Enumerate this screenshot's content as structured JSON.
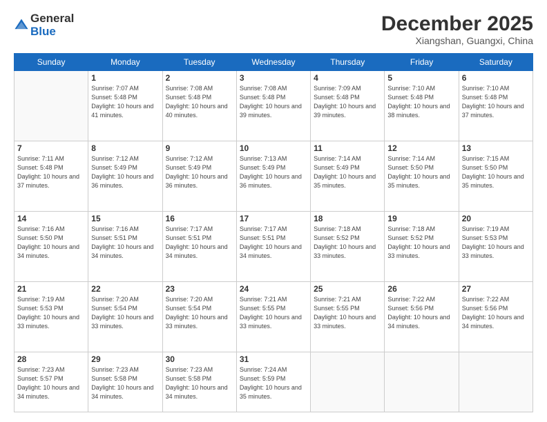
{
  "header": {
    "logo_line1": "General",
    "logo_line2": "Blue",
    "month": "December 2025",
    "location": "Xiangshan, Guangxi, China"
  },
  "weekdays": [
    "Sunday",
    "Monday",
    "Tuesday",
    "Wednesday",
    "Thursday",
    "Friday",
    "Saturday"
  ],
  "weeks": [
    [
      {
        "day": "",
        "info": ""
      },
      {
        "day": "1",
        "info": "Sunrise: 7:07 AM\nSunset: 5:48 PM\nDaylight: 10 hours\nand 41 minutes."
      },
      {
        "day": "2",
        "info": "Sunrise: 7:08 AM\nSunset: 5:48 PM\nDaylight: 10 hours\nand 40 minutes."
      },
      {
        "day": "3",
        "info": "Sunrise: 7:08 AM\nSunset: 5:48 PM\nDaylight: 10 hours\nand 39 minutes."
      },
      {
        "day": "4",
        "info": "Sunrise: 7:09 AM\nSunset: 5:48 PM\nDaylight: 10 hours\nand 39 minutes."
      },
      {
        "day": "5",
        "info": "Sunrise: 7:10 AM\nSunset: 5:48 PM\nDaylight: 10 hours\nand 38 minutes."
      },
      {
        "day": "6",
        "info": "Sunrise: 7:10 AM\nSunset: 5:48 PM\nDaylight: 10 hours\nand 37 minutes."
      }
    ],
    [
      {
        "day": "7",
        "info": "Sunrise: 7:11 AM\nSunset: 5:48 PM\nDaylight: 10 hours\nand 37 minutes."
      },
      {
        "day": "8",
        "info": "Sunrise: 7:12 AM\nSunset: 5:49 PM\nDaylight: 10 hours\nand 36 minutes."
      },
      {
        "day": "9",
        "info": "Sunrise: 7:12 AM\nSunset: 5:49 PM\nDaylight: 10 hours\nand 36 minutes."
      },
      {
        "day": "10",
        "info": "Sunrise: 7:13 AM\nSunset: 5:49 PM\nDaylight: 10 hours\nand 36 minutes."
      },
      {
        "day": "11",
        "info": "Sunrise: 7:14 AM\nSunset: 5:49 PM\nDaylight: 10 hours\nand 35 minutes."
      },
      {
        "day": "12",
        "info": "Sunrise: 7:14 AM\nSunset: 5:50 PM\nDaylight: 10 hours\nand 35 minutes."
      },
      {
        "day": "13",
        "info": "Sunrise: 7:15 AM\nSunset: 5:50 PM\nDaylight: 10 hours\nand 35 minutes."
      }
    ],
    [
      {
        "day": "14",
        "info": "Sunrise: 7:16 AM\nSunset: 5:50 PM\nDaylight: 10 hours\nand 34 minutes."
      },
      {
        "day": "15",
        "info": "Sunrise: 7:16 AM\nSunset: 5:51 PM\nDaylight: 10 hours\nand 34 minutes."
      },
      {
        "day": "16",
        "info": "Sunrise: 7:17 AM\nSunset: 5:51 PM\nDaylight: 10 hours\nand 34 minutes."
      },
      {
        "day": "17",
        "info": "Sunrise: 7:17 AM\nSunset: 5:51 PM\nDaylight: 10 hours\nand 34 minutes."
      },
      {
        "day": "18",
        "info": "Sunrise: 7:18 AM\nSunset: 5:52 PM\nDaylight: 10 hours\nand 33 minutes."
      },
      {
        "day": "19",
        "info": "Sunrise: 7:18 AM\nSunset: 5:52 PM\nDaylight: 10 hours\nand 33 minutes."
      },
      {
        "day": "20",
        "info": "Sunrise: 7:19 AM\nSunset: 5:53 PM\nDaylight: 10 hours\nand 33 minutes."
      }
    ],
    [
      {
        "day": "21",
        "info": "Sunrise: 7:19 AM\nSunset: 5:53 PM\nDaylight: 10 hours\nand 33 minutes."
      },
      {
        "day": "22",
        "info": "Sunrise: 7:20 AM\nSunset: 5:54 PM\nDaylight: 10 hours\nand 33 minutes."
      },
      {
        "day": "23",
        "info": "Sunrise: 7:20 AM\nSunset: 5:54 PM\nDaylight: 10 hours\nand 33 minutes."
      },
      {
        "day": "24",
        "info": "Sunrise: 7:21 AM\nSunset: 5:55 PM\nDaylight: 10 hours\nand 33 minutes."
      },
      {
        "day": "25",
        "info": "Sunrise: 7:21 AM\nSunset: 5:55 PM\nDaylight: 10 hours\nand 33 minutes."
      },
      {
        "day": "26",
        "info": "Sunrise: 7:22 AM\nSunset: 5:56 PM\nDaylight: 10 hours\nand 34 minutes."
      },
      {
        "day": "27",
        "info": "Sunrise: 7:22 AM\nSunset: 5:56 PM\nDaylight: 10 hours\nand 34 minutes."
      }
    ],
    [
      {
        "day": "28",
        "info": "Sunrise: 7:23 AM\nSunset: 5:57 PM\nDaylight: 10 hours\nand 34 minutes."
      },
      {
        "day": "29",
        "info": "Sunrise: 7:23 AM\nSunset: 5:58 PM\nDaylight: 10 hours\nand 34 minutes."
      },
      {
        "day": "30",
        "info": "Sunrise: 7:23 AM\nSunset: 5:58 PM\nDaylight: 10 hours\nand 34 minutes."
      },
      {
        "day": "31",
        "info": "Sunrise: 7:24 AM\nSunset: 5:59 PM\nDaylight: 10 hours\nand 35 minutes."
      },
      {
        "day": "",
        "info": ""
      },
      {
        "day": "",
        "info": ""
      },
      {
        "day": "",
        "info": ""
      }
    ]
  ]
}
